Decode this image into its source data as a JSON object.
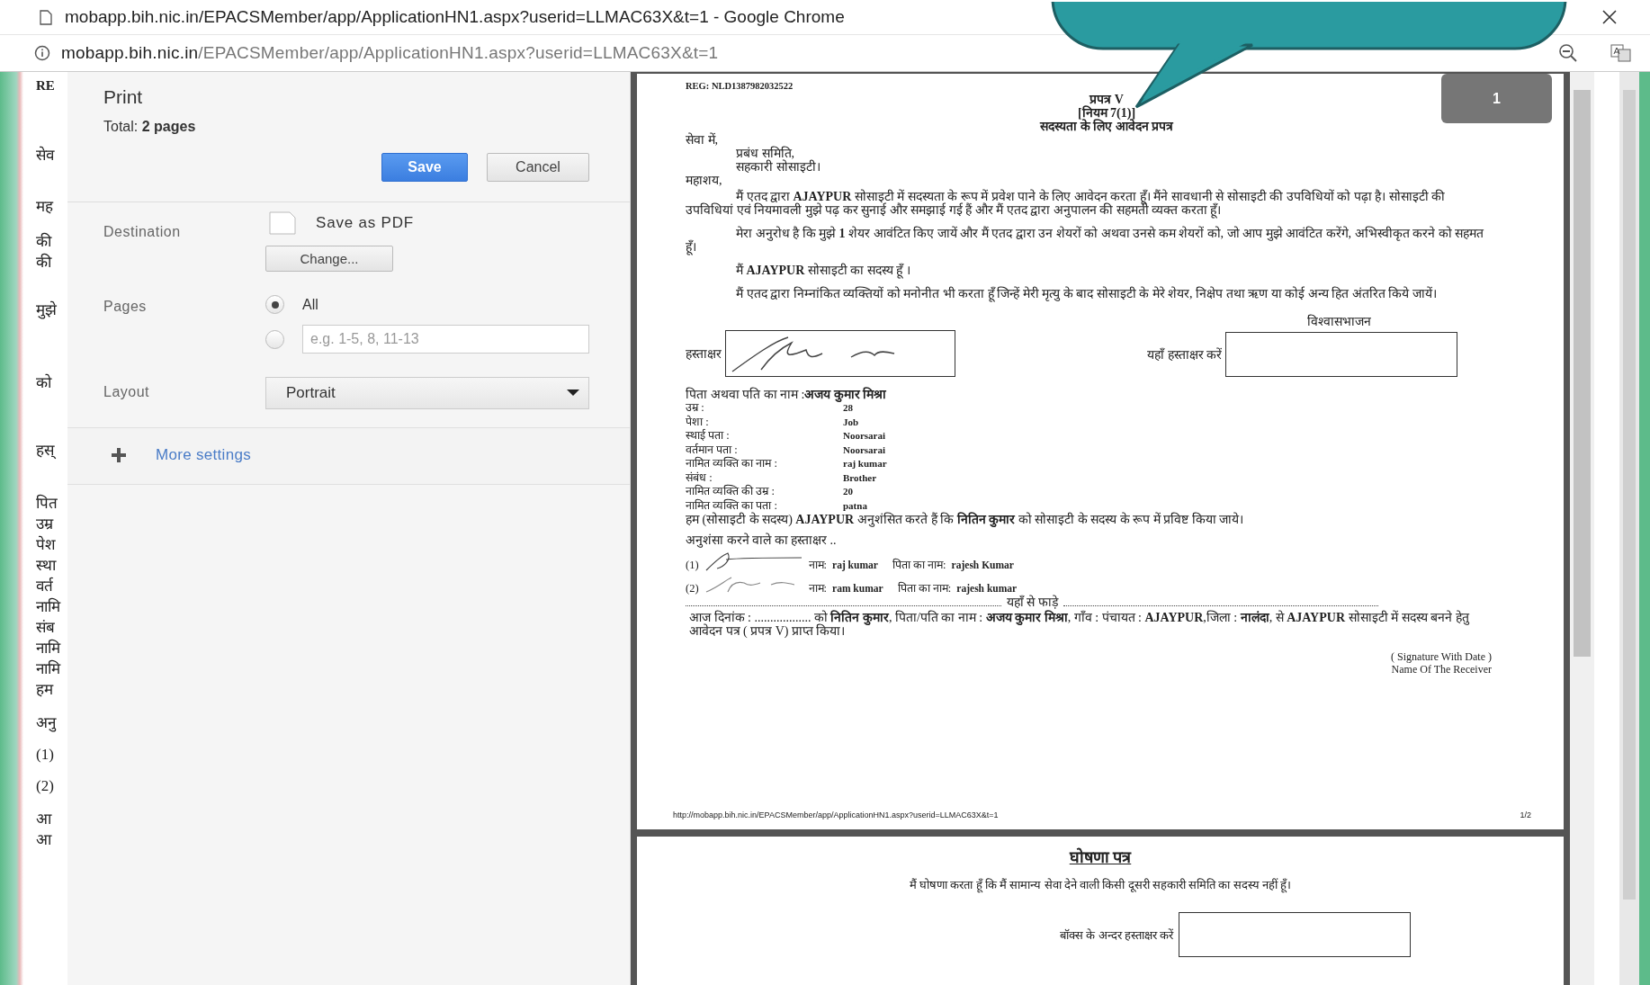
{
  "window": {
    "title": "mobapp.bih.nic.in/EPACSMember/app/ApplicationHN1.aspx?userid=LLMAC63X&t=1 - Google Chrome"
  },
  "address_bar": {
    "host": "mobapp.bih.nic.in",
    "path": "/EPACSMember/app/ApplicationHN1.aspx?userid=LLMAC63X&t=1"
  },
  "background_page": {
    "fragments": [
      "RE",
      "सेव",
      "मह",
      "की",
      "की",
      "मुझे",
      "को",
      "हस्",
      "पित",
      "उम्र",
      "पेश",
      "स्था",
      "वर्त",
      "नामि",
      "संब",
      "नामि",
      "नामि",
      "हम",
      "अनु",
      "(1)",
      "(2)",
      "आ",
      "आ"
    ]
  },
  "print_dialog": {
    "title": "Print",
    "total": "Total: **2 pages**",
    "buttons": [
      {
        "label": "Save",
        "kind": "primary"
      },
      {
        "label": "Cancel",
        "kind": "secondary"
      }
    ],
    "destination": {
      "label": "Destination",
      "value": "Save as PDF",
      "change_button": "Change..."
    },
    "pages": {
      "label": "Pages",
      "options": [
        {
          "kind": "all",
          "label": "All",
          "selected": true
        },
        {
          "kind": "range",
          "placeholder": "e.g. 1-5, 8, 11-13",
          "selected": false
        }
      ]
    },
    "layout": {
      "label": "Layout",
      "value": "Portrait"
    },
    "more_settings": "More settings"
  },
  "preview": {
    "page_badge": "1",
    "page1": {
      "reg": "REG: NLD1387982032522",
      "heading": [
        "प्रपत्र V",
        "[नियम 7(1)]",
        "सदस्यता के लिए आवेदन प्रपत्र"
      ],
      "address_lines": [
        {
          "text": "सेवा में,",
          "kind": "plain"
        },
        {
          "text": "प्रबंध समिति,",
          "kind": "indented"
        },
        {
          "text": "सहकारी सोसाइटी।",
          "kind": "indented"
        },
        {
          "text": "महाशय,",
          "kind": "plain"
        }
      ],
      "paragraphs": [
        "मैं एतद द्वारा  **AJAYPUR**  सोसाइटी में सदस्यता के रूप में प्रवेश पाने के लिए आवेदन करता हूँ। मैंने सावधानी से सोसाइटी की उपविधियों को पढ़ा है। सोसाइटी की उपविधियां एवं नियमावली मुझे पढ़ कर सुनाई और समझाई गई हैं और मैं एतद द्वारा अनुपालन की सहमती व्यक्त करता हूँ।",
        "मेरा अनुरोध है कि मुझे  **1**  शेयर आवंटित किए जायें और मैं एतद द्वारा उन शेयरों को अथवा उनसे कम शेयरों को, जो आप मुझे आवंटित करेंगे, अभिस्वीकृत करने को सहमत हूँ।",
        "मैं  **AJAYPUR**  सोसाइटी का सदस्य  हूँ  ।",
        "मैं एतद द्वारा निम्नांकित व्यक्तियों को मनोनीत भी करता हूँ जिन्हें मेरी मृत्यु के बाद सोसाइटी के मेरे शेयर, निक्षेप तथा ऋण या कोई अन्य हित अंतरित किये जायें।"
      ],
      "signature_label": "हस्ताक्षर",
      "receiver_caption": "विश्वासभाजन",
      "receiver_label": "यहाँ हस्ताक्षर करें",
      "parent_name": {
        "label": "पिता अथवा पति का नाम :",
        "value": "अजय कुमार मिश्रा"
      },
      "details": [
        {
          "label": "उम्र :",
          "value": "28"
        },
        {
          "label": "पेशा :",
          "value": "Job"
        },
        {
          "label": "स्थाई पता :",
          "value": "Noorsarai"
        },
        {
          "label": "वर्तमान पता :",
          "value": "Noorsarai"
        },
        {
          "label": "नामित व्यक्ति का नाम :",
          "value": "raj kumar"
        },
        {
          "label": "संबंध :",
          "value": "Brother"
        },
        {
          "label": "नामित व्यक्ति की उम्र :",
          "value": "20"
        },
        {
          "label": "नामित व्यक्ति का पता :",
          "value": "patna"
        }
      ],
      "recommendation": "हम (सोसाइटी के सदस्य) **AJAYPUR** अनुशंसित करते हैं कि **नितिन कुमार** को सोसाइटी के सदस्य के रूप में प्रविष्ट किया जाये।",
      "recommenders_heading": "अनुशंसा करने वाले का हस्ताक्षर ..",
      "recommenders": [
        {
          "number": "(1)",
          "name_label": "नाम:",
          "name": "raj kumar",
          "father_label": "पिता का नाम:",
          "father": "rajesh Kumar"
        },
        {
          "number": "(2)",
          "name_label": "नाम:",
          "name": "ram kumar",
          "father_label": "पिता का नाम:",
          "father": "rajesh kumar"
        }
      ],
      "tear_line": "यहाँ से फाड़े",
      "receipt": "आज दिनांक : .................. को **नितिन कुमार**, पिता/पति का नाम : **अजय कुमार मिश्रा**, गाँव : पंचायत : **AJAYPUR**,जिला : **नालंदा**, से **AJAYPUR** सोसाइटी में सदस्य बनने हेतु आवेदन पत्र ( प्रपत्र V) प्राप्त किया।",
      "receiver_sign": [
        "( Signature With Date )",
        "Name Of The Receiver"
      ],
      "footer": {
        "url": "http://mobapp.bih.nic.in/EPACSMember/app/ApplicationHN1.aspx?userid=LLMAC63X&t=1",
        "page": "1/2"
      }
    },
    "page2": {
      "title": "घोषणा पत्र",
      "statement": "मैं घोषणा करता हूँ कि मैं सामान्य सेवा देने वाली किसी दूसरी सहकारी समिति का सदस्य नहीं हूँ।",
      "sign_label": "बॉक्स के अन्दर हस्ताक्षर करें"
    }
  }
}
